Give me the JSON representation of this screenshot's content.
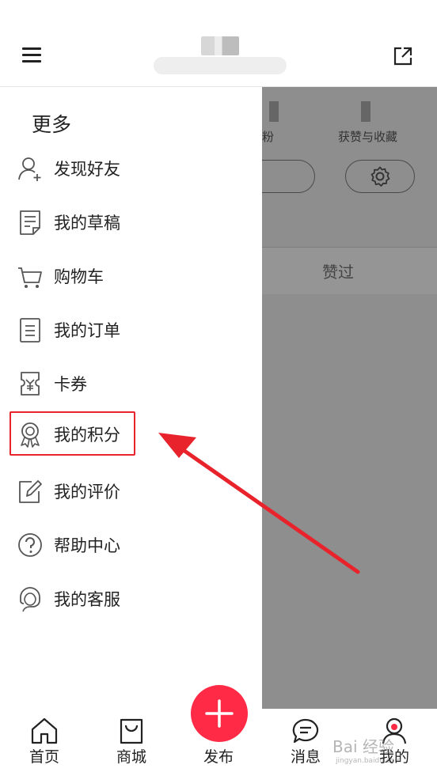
{
  "header": {
    "menu_icon": "hamburger-icon",
    "share_icon": "share-external-icon"
  },
  "background_profile": {
    "stat_fans_label": "粉",
    "stat_likes_label": "获赞与收藏",
    "tab_praised": "赞过",
    "settings_icon": "gear-icon"
  },
  "drawer": {
    "title": "更多",
    "items": [
      {
        "label": "发现好友",
        "icon": "add-user-icon"
      },
      {
        "label": "我的草稿",
        "icon": "draft-icon"
      },
      {
        "label": "购物车",
        "icon": "cart-icon"
      },
      {
        "label": "我的订单",
        "icon": "order-icon"
      },
      {
        "label": "卡券",
        "icon": "coupon-icon"
      },
      {
        "label": "我的积分",
        "icon": "medal-icon"
      },
      {
        "label": "我的评价",
        "icon": "review-edit-icon"
      },
      {
        "label": "帮助中心",
        "icon": "help-icon"
      },
      {
        "label": "我的客服",
        "icon": "customer-service-icon"
      }
    ]
  },
  "tabbar": {
    "items": [
      {
        "label": "首页",
        "icon": "home-icon"
      },
      {
        "label": "商城",
        "icon": "shopping-bag-icon"
      },
      {
        "label": "发布",
        "icon": "plus-icon"
      },
      {
        "label": "消息",
        "icon": "message-icon"
      },
      {
        "label": "我的",
        "icon": "profile-icon"
      }
    ]
  },
  "colors": {
    "accent": "#ff2a45",
    "annotation": "#e8232b",
    "overlay": "#8e8e8e"
  },
  "watermark": {
    "brand": "Bai 经验",
    "url": "jingyan.baidu.com"
  }
}
